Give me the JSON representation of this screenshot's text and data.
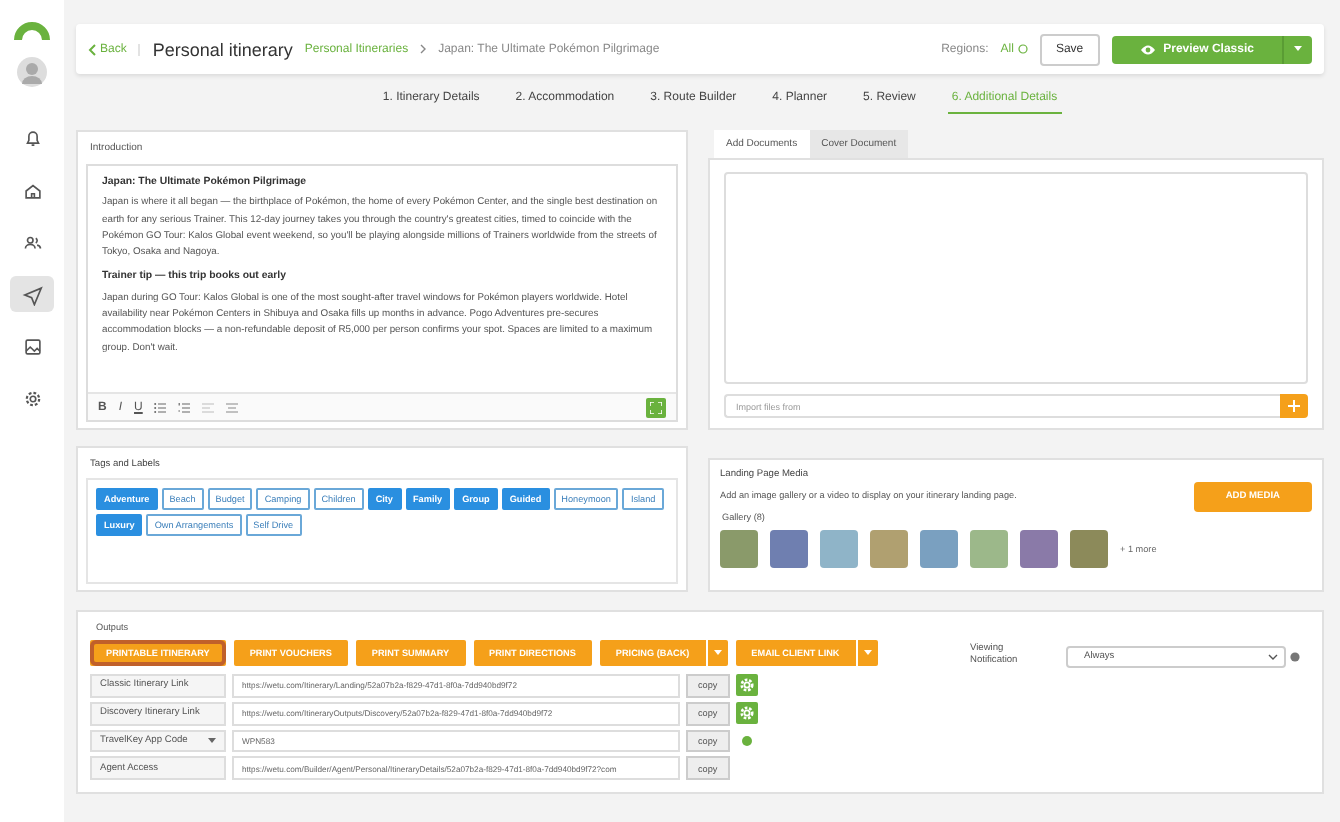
{
  "sidebar": {
    "items": [
      {
        "kind": "bell",
        "selected": false
      },
      {
        "kind": "home",
        "selected": false
      },
      {
        "kind": "people",
        "selected": false
      },
      {
        "kind": "send",
        "selected": true
      },
      {
        "kind": "image",
        "selected": false
      },
      {
        "kind": "gear",
        "selected": false
      }
    ]
  },
  "header": {
    "back": "Back",
    "title": "Personal itinerary",
    "breadcrumb": [
      "Personal Itineraries",
      "Japan: The Ultimate Pokémon Pilgrimage"
    ],
    "regions_label": "Regions:",
    "regions_value": "All",
    "save": "Save",
    "preview": "Preview Classic"
  },
  "steps": [
    {
      "label": "1. Itinerary Details",
      "selected": false
    },
    {
      "label": "2. Accommodation",
      "selected": false
    },
    {
      "label": "3. Route Builder",
      "selected": false
    },
    {
      "label": "4. Planner",
      "selected": false
    },
    {
      "label": "5. Review",
      "selected": false
    },
    {
      "label": "6. Additional Details",
      "selected": true
    }
  ],
  "introduction": {
    "label": "Introduction",
    "content": [
      {
        "kind": "heading",
        "text": "Japan: The Ultimate Pokémon Pilgrimage"
      },
      {
        "kind": "paragraph",
        "text": "Japan is where it all began — the birthplace of Pokémon, the home of every Pokémon Center, and the single best destination on earth for any serious Trainer. This 12-day journey takes you through the country's greatest cities, timed to coincide with the Pokémon GO Tour: Kalos Global event weekend, so you'll be playing alongside millions of Trainers worldwide from the streets of Tokyo, Osaka and Nagoya."
      },
      {
        "kind": "heading",
        "text": "Trainer tip — this trip books out early"
      },
      {
        "kind": "paragraph",
        "text": "Japan during GO Tour: Kalos Global is one of the most sought-after travel windows for Pokémon players worldwide. Hotel availability near Pokémon Centers in Shibuya and Osaka fills up months in advance. Pogo Adventures pre-secures accommodation blocks — a non-refundable deposit of R5,000 per person confirms your spot. Spaces are limited to a maximum group. Don't wait."
      }
    ],
    "toolbar": [
      "B",
      "I",
      "U"
    ]
  },
  "documents": {
    "tabs": [
      {
        "label": "Add Documents",
        "selected": true
      },
      {
        "label": "Cover Document",
        "selected": false
      }
    ],
    "import_placeholder": "Import files from"
  },
  "tags": {
    "label": "Tags and Labels",
    "items": [
      {
        "label": "Adventure",
        "selected": true
      },
      {
        "label": "Beach",
        "selected": false
      },
      {
        "label": "Budget",
        "selected": false
      },
      {
        "label": "Camping",
        "selected": false
      },
      {
        "label": "Children",
        "selected": false
      },
      {
        "label": "City",
        "selected": true
      },
      {
        "label": "Family",
        "selected": true
      },
      {
        "label": "Group",
        "selected": true
      },
      {
        "label": "Guided",
        "selected": true
      },
      {
        "label": "Honeymoon",
        "selected": false
      },
      {
        "label": "Island",
        "selected": false
      },
      {
        "label": "Luxury",
        "selected": true
      },
      {
        "label": "Own Arrangements",
        "selected": false
      },
      {
        "label": "Self Drive",
        "selected": false
      }
    ]
  },
  "media": {
    "label": "Landing Page Media",
    "description": "Add an image gallery or a video to display on your itinerary landing page.",
    "button": "ADD MEDIA",
    "gallery_label": "Gallery (8)",
    "more": "+ 1 more"
  },
  "outputs": {
    "label": "Outputs",
    "buttons": [
      {
        "label": "PRINTABLE ITINERARY",
        "highlighted": true,
        "split": false
      },
      {
        "label": "PRINT VOUCHERS",
        "highlighted": false,
        "split": false
      },
      {
        "label": "PRINT SUMMARY",
        "highlighted": false,
        "split": false
      },
      {
        "label": "PRINT DIRECTIONS",
        "highlighted": false,
        "split": false
      },
      {
        "label": "PRICING (BACK)",
        "highlighted": false,
        "split": true
      },
      {
        "label": "EMAIL CLIENT LINK",
        "highlighted": false,
        "split": true
      }
    ],
    "links": [
      {
        "label": "Classic Itinerary Link",
        "dropdown": false,
        "value": "https://wetu.com/Itinerary/Landing/52a07b2a-f829-47d1-8f0a-7dd940bd9f72",
        "copy": "copy",
        "kind": "settings"
      },
      {
        "label": "Discovery Itinerary Link",
        "dropdown": false,
        "value": "https://wetu.com/ItineraryOutputs/Discovery/52a07b2a-f829-47d1-8f0a-7dd940bd9f72",
        "copy": "copy",
        "kind": "settings"
      },
      {
        "label": "TravelKey App Code",
        "dropdown": true,
        "value": "WPN583",
        "copy": "copy",
        "kind": "info"
      },
      {
        "label": "Agent Access",
        "dropdown": false,
        "value": "https://wetu.com/Builder/Agent/Personal/ItineraryDetails/52a07b2a-f829-47d1-8f0a-7dd940bd9f72?com",
        "copy": "copy",
        "kind": "plain"
      }
    ],
    "notification": {
      "label": "Viewing Notification",
      "value": "Always"
    }
  }
}
